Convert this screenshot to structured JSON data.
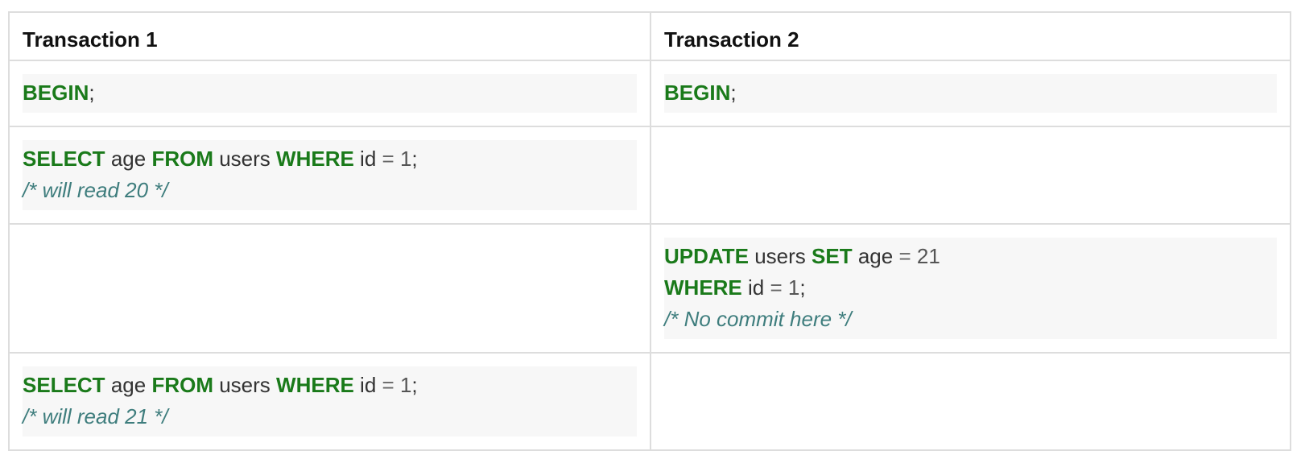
{
  "headers": [
    "Transaction 1",
    "Transaction 2"
  ],
  "steps": {
    "begin": {
      "keyword": "BEGIN",
      "semicolon": ";"
    },
    "select": {
      "kw_select": "SELECT",
      "col": "age",
      "kw_from": "FROM",
      "table": "users",
      "kw_where": "WHERE",
      "id_col": "id",
      "eq": "=",
      "id_val": "1",
      "semi": ";"
    },
    "select_comment_1": "/* will read 20 */",
    "update": {
      "kw_update": "UPDATE",
      "table": "users",
      "kw_set": "SET",
      "col": "age",
      "eq": "=",
      "new_val": "21",
      "kw_where": "WHERE",
      "id_col": "id",
      "id_val": "1",
      "semi": ";",
      "comment": "/* No commit here */"
    },
    "select_comment_2": "/* will read 21 */"
  }
}
